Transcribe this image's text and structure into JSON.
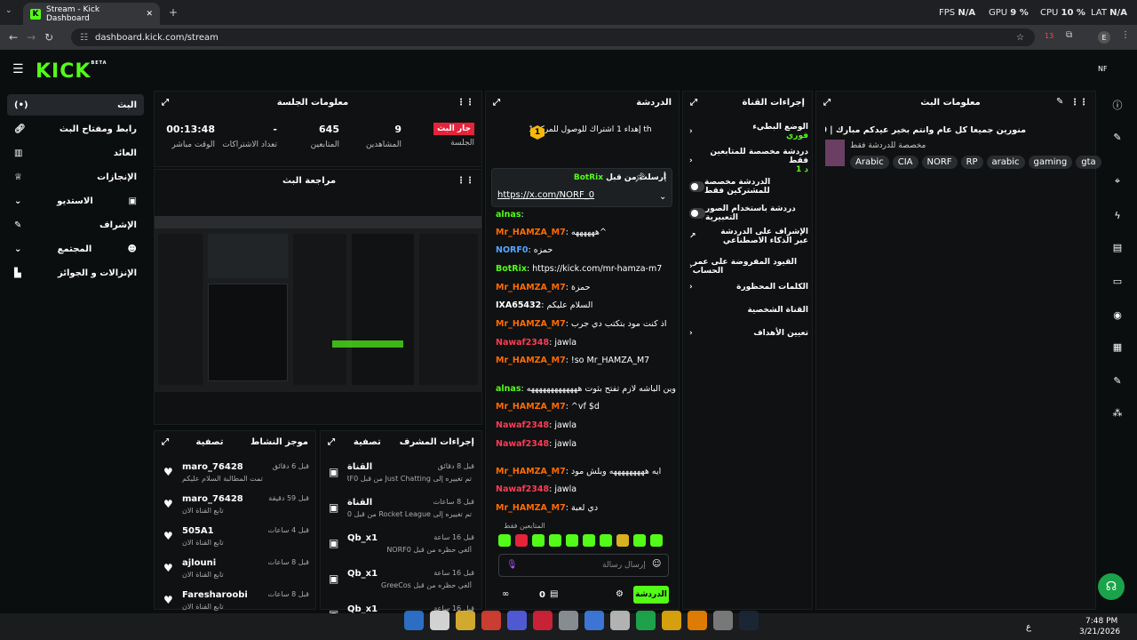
{
  "browser": {
    "tab_title": "Stream - Kick Dashboard",
    "url": "dashboard.kick.com/stream",
    "fps_label": "FPS",
    "fps_val": "N/A",
    "gpu_label": "GPU",
    "gpu_val": "9 %",
    "cpu_label": "CPU",
    "cpu_val": "10 %",
    "lat_label": "LAT",
    "lat_val": "N/A",
    "ext_badge": "13",
    "profile": "E"
  },
  "app": {
    "logo": "KICK",
    "beta": "BETA",
    "user": "NF"
  },
  "sidebar": {
    "items": [
      {
        "label": "البث",
        "active": true
      },
      {
        "label": "رابط ومفتاح البث"
      },
      {
        "label": "العائد"
      },
      {
        "label": "الإنجازات"
      },
      {
        "label": "الاستديو"
      },
      {
        "label": "الإشراف"
      },
      {
        "label": "المجتمع"
      },
      {
        "label": "الإنزالات و الجوائز"
      }
    ]
  },
  "session": {
    "title": "معلومات الجلسة",
    "live_badge": "جار البث",
    "live_label": "الجلسة",
    "viewers_val": "9",
    "viewers_label": "المشاهدين",
    "followers_val": "645",
    "followers_label": "المتابعين",
    "subs_val": "-",
    "subs_label": "تعداد الاشتراكات",
    "uptime_val": "00:13:48",
    "uptime_label": "الوقت مباشر"
  },
  "preview": {
    "title": "مراجعة البث"
  },
  "activity": {
    "title": "موجز النشاط",
    "filter": "تصفية",
    "items": [
      {
        "user": "maro_76428",
        "time": "قبل 6 دقائق",
        "text": "تمت المطالبة السلام عليكم"
      },
      {
        "user": "maro_76428",
        "time": "قبل 59 دقيقة",
        "text": "تابع القناة الان"
      },
      {
        "user": "505A1",
        "time": "قبل 4 ساعات",
        "text": "تابع القناة الان"
      },
      {
        "user": "ajlouni",
        "time": "قبل 8 ساعات",
        "text": "تابع القناة الان"
      },
      {
        "user": "Faresharoobi",
        "time": "قبل 8 ساعات",
        "text": "تابع القناة الان"
      }
    ]
  },
  "modactions": {
    "title": "إجراءات المشرف",
    "filter": "تصفية",
    "items": [
      {
        "user": "القناة",
        "time": "قبل 8 دقائق",
        "text": "تم تغييره إلى Just Chatting من قبل NORF0"
      },
      {
        "user": "القناة",
        "time": "قبل 8 ساعات",
        "text": "تم تغييره إلى Rocket League من قبل NORF0"
      },
      {
        "user": "Qb_x1",
        "time": "قبل 16 ساعة",
        "text": "ألغي حظره من قبل NORF0"
      },
      {
        "user": "Qb_x1",
        "time": "قبل 16 ساعة",
        "text": "ألغي حظره من قبل GreeCos"
      },
      {
        "user": "Qb_x1",
        "time": "قبل 16 ساعة",
        "text": ""
      }
    ]
  },
  "chat": {
    "title": "الدردشة",
    "goal": "إهداء 1 اشتراك للوصول للمركز 1 th",
    "rank": "1",
    "pinned_by": "أرسلت من قبل",
    "pinned_user": "BotRix",
    "pinned_link": "https://x.com/NORF_0",
    "followers_only": "المتابعين فقط",
    "input_placeholder": "إرسال رسالة",
    "count": "0",
    "send": "الدردشة",
    "messages": [
      {
        "user": "alnas",
        "text": ":"
      },
      {
        "user": "Mr_HAMZA_M7",
        "text": ": ههههههه^"
      },
      {
        "user": "NORF0",
        "text": ": حمزه"
      },
      {
        "user": "BotRix",
        "text": ": https://kick.com/mr-hamza-m7"
      },
      {
        "user": "Mr_HAMZA_M7",
        "text": ": حمزة"
      },
      {
        "user": "IXA65432",
        "text": ": السلام عليكم"
      },
      {
        "user": "Mr_HAMZA_M7",
        "text": ": اذ كنت مود بتكتب دي جرب"
      },
      {
        "user": "Nawaf2348",
        "text": ": jawla"
      },
      {
        "user": "Mr_HAMZA_M7",
        "text": ": !so Mr_HAMZA_M7"
      },
      {
        "user": "alnas",
        "text": ": وين الباشه لازم تفتح بثوت هههههههههههههه"
      },
      {
        "user": "Mr_HAMZA_M7",
        "text": ": ^vf $d"
      },
      {
        "user": "Nawaf2348",
        "text": ": jawla"
      },
      {
        "user": "Nawaf2348",
        "text": ": jawla"
      },
      {
        "user": "Mr_HAMZA_M7",
        "text": ": ايه هههههههههه وبلش مود"
      },
      {
        "user": "Nawaf2348",
        "text": ": jawla"
      },
      {
        "user": "Mr_HAMZA_M7",
        "text": ": دي لعبة"
      }
    ]
  },
  "channel_actions": {
    "title": "إجراءات القناة",
    "items": [
      {
        "label": "الوضع البطيء",
        "sub": "فوري"
      },
      {
        "label": "دردشة مخصصة للمتابعين فقط",
        "sub": "د 1"
      },
      {
        "label": "الدردشة مخصصة للمشتركين فقط"
      },
      {
        "label": "دردشة باستخدام الصور التعبيرية"
      },
      {
        "label": "الإشراف على الدردشة عبر الذكاء الاصطناعي"
      },
      {
        "label": "القيود المفروضة على عمر الحساب"
      },
      {
        "label": "الكلمات المحظورة"
      },
      {
        "label": "القناة الشخصية"
      },
      {
        "label": "تعيين الأهداف"
      }
    ]
  },
  "stream_info": {
    "title": "معلومات البث",
    "stream_title": "منورين جميعا كل عام وانتم بخير عيدكم مبارك | 1000 | ITG | IMT!",
    "sub": "مخصصة للدردشة فقط",
    "tags": [
      "Arabic",
      "CIA",
      "NORF",
      "RP",
      "arabic",
      "gaming",
      "gta"
    ]
  },
  "taskbar": {
    "time": "7:48 PM",
    "date": "3/21/2026",
    "lang": "ع"
  },
  "colors": {
    "accent": "#53fc18",
    "live": "#e5233b",
    "bg": "#0b0e0f"
  }
}
